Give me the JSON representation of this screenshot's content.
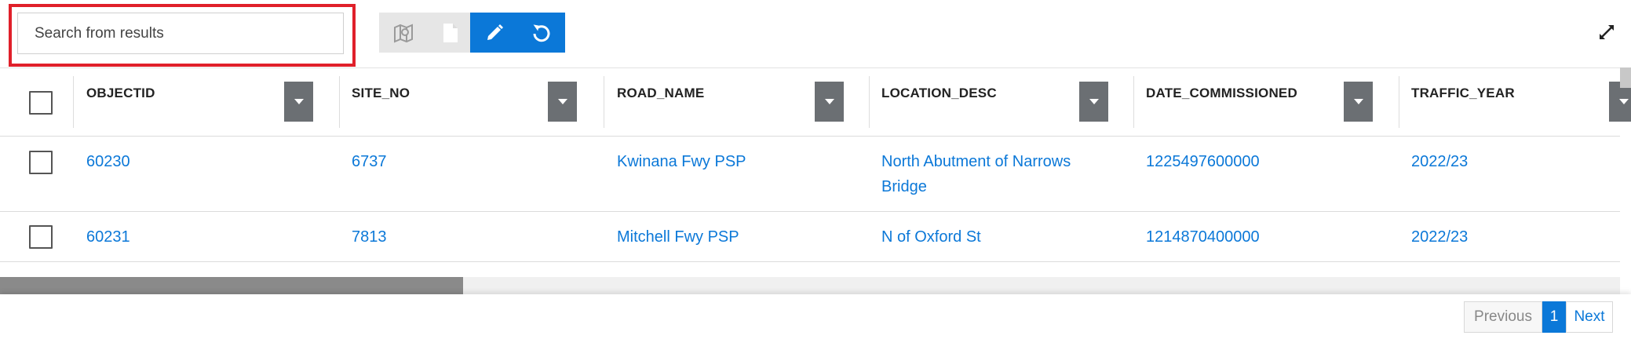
{
  "search": {
    "placeholder": "Search from results",
    "value": ""
  },
  "toolbar": {
    "buttons": [
      {
        "icon": "map-select-icon",
        "state": "disabled"
      },
      {
        "icon": "document-icon",
        "state": "disabled"
      },
      {
        "icon": "pencil-icon",
        "state": "active"
      },
      {
        "icon": "refresh-icon",
        "state": "active"
      }
    ],
    "expand_icon": "expand-icon"
  },
  "table": {
    "columns": [
      "OBJECTID",
      "SITE_NO",
      "ROAD_NAME",
      "LOCATION_DESC",
      "DATE_COMMISSIONED",
      "TRAFFIC_YEAR"
    ],
    "rows": [
      {
        "OBJECTID": "60230",
        "SITE_NO": "6737",
        "ROAD_NAME": "Kwinana Fwy PSP",
        "LOCATION_DESC_line1": "North Abutment of Narrows",
        "LOCATION_DESC_line2": "Bridge",
        "DATE_COMMISSIONED": "1225497600000",
        "TRAFFIC_YEAR": "2022/23"
      },
      {
        "OBJECTID": "60231",
        "SITE_NO": "7813",
        "ROAD_NAME": "Mitchell Fwy PSP",
        "LOCATION_DESC_line1": "N of Oxford St",
        "LOCATION_DESC_line2": "",
        "DATE_COMMISSIONED": "1214870400000",
        "TRAFFIC_YEAR": "2022/23"
      }
    ]
  },
  "pagination": {
    "previous": "Previous",
    "current": "1",
    "next": "Next"
  },
  "colors": {
    "accent": "#0b78d8",
    "highlight": "#e0202a",
    "header_menu": "#6b6f73"
  }
}
